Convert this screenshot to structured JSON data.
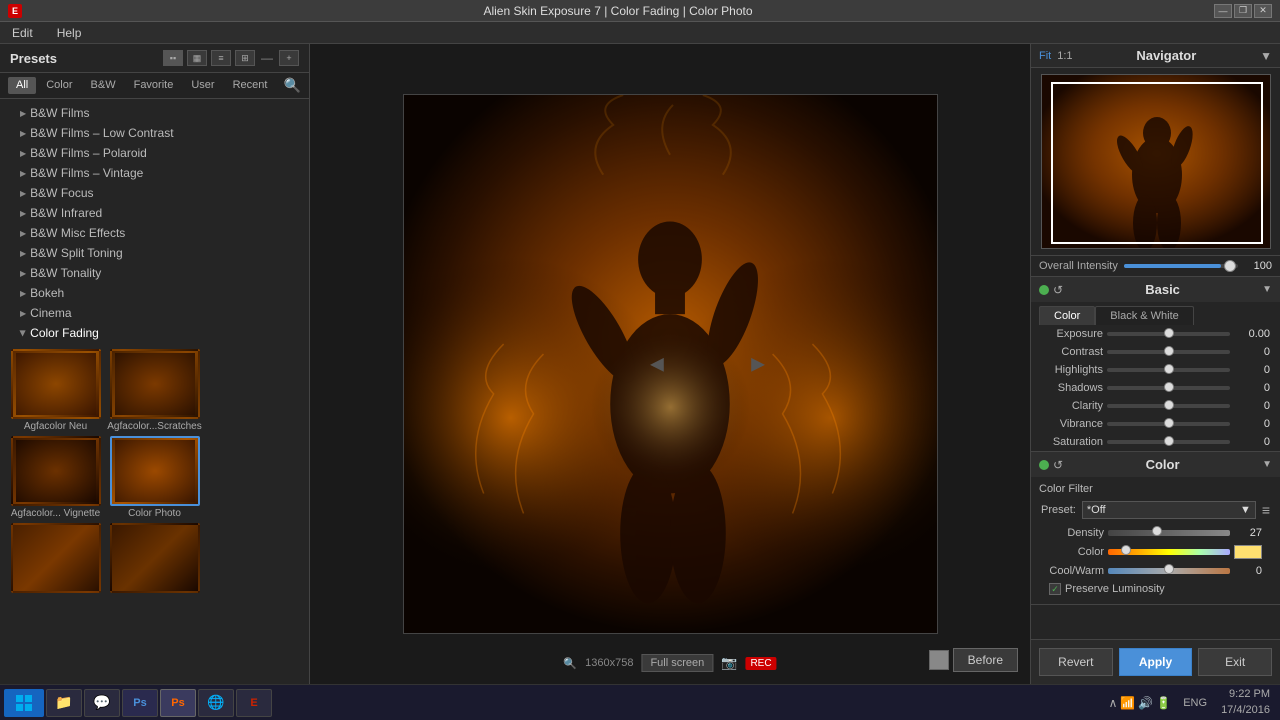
{
  "titlebar": {
    "title": "Alien Skin Exposure 7 | Color Fading | Color Photo",
    "icon": "E",
    "min": "—",
    "max": "❐",
    "close": "✕"
  },
  "menu": {
    "items": [
      "Edit",
      "Help"
    ]
  },
  "presets": {
    "title": "Presets",
    "filters": [
      "All",
      "Color",
      "B&W",
      "Favorite",
      "User",
      "Recent"
    ],
    "active_filter": "All",
    "categories": [
      {
        "id": "bw-films",
        "label": "B&W Films",
        "expanded": false
      },
      {
        "id": "bw-films-low",
        "label": "B&W Films – Low Contrast",
        "expanded": false
      },
      {
        "id": "bw-films-polaroid",
        "label": "B&W Films – Polaroid",
        "expanded": false
      },
      {
        "id": "bw-films-vintage",
        "label": "B&W Films – Vintage",
        "expanded": false
      },
      {
        "id": "bw-focus",
        "label": "B&W Focus",
        "expanded": false
      },
      {
        "id": "bw-infrared",
        "label": "B&W Infrared",
        "expanded": false
      },
      {
        "id": "bw-misc",
        "label": "B&W Misc Effects",
        "expanded": false
      },
      {
        "id": "bw-split",
        "label": "B&W Split Toning",
        "expanded": false
      },
      {
        "id": "bw-tonality",
        "label": "B&W Tonality",
        "expanded": false
      },
      {
        "id": "bokeh",
        "label": "Bokeh",
        "expanded": false
      },
      {
        "id": "cinema",
        "label": "Cinema",
        "expanded": false
      },
      {
        "id": "color-fading",
        "label": "Color Fading",
        "expanded": true
      }
    ],
    "thumbnails": [
      {
        "id": "agfacolor-neu",
        "label": "Agfacolor Neu",
        "selected": false
      },
      {
        "id": "agfacolor-scratches",
        "label": "Agfacolor...Scratches",
        "selected": false
      },
      {
        "id": "agfacolor-vignette",
        "label": "Agfacolor... Vignette",
        "selected": false
      },
      {
        "id": "color-photo",
        "label": "Color Photo",
        "selected": true
      }
    ],
    "extra_thumbs": [
      {
        "id": "extra1",
        "label": ""
      },
      {
        "id": "extra2",
        "label": ""
      }
    ]
  },
  "navigator": {
    "title": "Navigator",
    "fit_label": "Fit",
    "ratio_label": "1:1"
  },
  "intensity": {
    "label": "Overall Intensity",
    "value": "100",
    "percent": 85
  },
  "basic_panel": {
    "title": "Basic",
    "tab_color": "Color",
    "tab_bw": "Black & White",
    "sliders": [
      {
        "id": "exposure",
        "label": "Exposure",
        "value": "0.00",
        "position": 50
      },
      {
        "id": "contrast",
        "label": "Contrast",
        "value": "0",
        "position": 50
      },
      {
        "id": "highlights",
        "label": "Highlights",
        "value": "0",
        "position": 50
      },
      {
        "id": "shadows",
        "label": "Shadows",
        "value": "0",
        "position": 50
      },
      {
        "id": "clarity",
        "label": "Clarity",
        "value": "0",
        "position": 50
      },
      {
        "id": "vibrance",
        "label": "Vibrance",
        "value": "0",
        "position": 50
      },
      {
        "id": "saturation",
        "label": "Saturation",
        "value": "0",
        "position": 50
      }
    ]
  },
  "color_panel": {
    "title": "Color",
    "filter_label": "Color Filter",
    "preset_label": "Preset:",
    "preset_value": "*Off",
    "density_label": "Density",
    "density_value": "27",
    "color_label": "Color",
    "cool_warm_label": "Cool/Warm",
    "cool_warm_value": "0",
    "preserve_label": "Preserve Luminosity",
    "preserve_checked": true
  },
  "buttons": {
    "revert": "Revert",
    "apply": "Apply",
    "exit": "Exit",
    "before": "Before"
  },
  "statusbar": {
    "zoom": "1360x758",
    "fullscreen": "Full screen"
  },
  "taskbar": {
    "time": "9:22 PM",
    "date": "17/4/2016",
    "apps": [
      "🪟",
      "📁",
      "💬",
      "🎨",
      "🎨",
      "🌐",
      "📊"
    ],
    "language": "ENG"
  }
}
